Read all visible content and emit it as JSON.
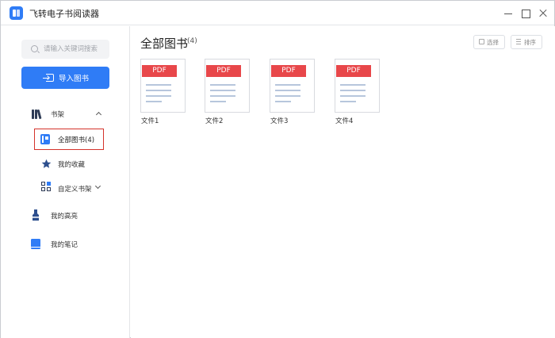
{
  "window": {
    "title": "飞转电子书阅读器",
    "controls": {
      "minimize": "minimize-icon",
      "maximize": "maximize-icon",
      "close": "close-icon"
    }
  },
  "colors": {
    "accent": "#2f7cf6",
    "selection_border": "#d4332b",
    "pdf_badge": "#e8474a"
  },
  "sidebar": {
    "search_placeholder": "请输入关键词搜索",
    "import_label": "导入图书",
    "bookshelf": {
      "label": "书架",
      "expanded": true,
      "children": [
        {
          "label": "全部图书(4)",
          "icon": "book-icon",
          "selected": true
        },
        {
          "label": "我的收藏",
          "icon": "star-icon"
        },
        {
          "label": "自定义书架",
          "icon": "grid-icon",
          "expandable": true
        }
      ]
    },
    "highlights_label": "我的高亮",
    "notes_label": "我的笔记"
  },
  "main": {
    "title": "全部图书",
    "count": "(4)",
    "select_label": "选择",
    "sort_label": "排序",
    "books": [
      {
        "badge": "PDF",
        "name": "文件1"
      },
      {
        "badge": "PDF",
        "name": "文件2"
      },
      {
        "badge": "PDF",
        "name": "文件3"
      },
      {
        "badge": "PDF",
        "name": "文件4"
      }
    ]
  }
}
